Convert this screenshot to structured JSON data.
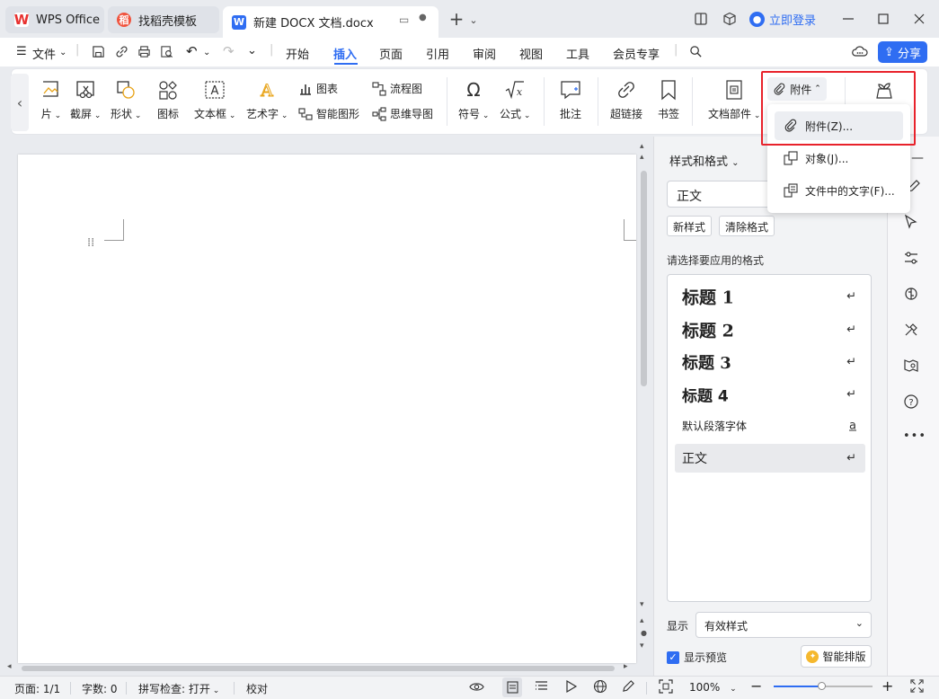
{
  "tabs": [
    {
      "label": "WPS Office",
      "icon": "wps-logo-icon"
    },
    {
      "label": "找稻壳模板",
      "icon": "daoke-icon"
    },
    {
      "label": "新建 DOCX 文档.docx",
      "icon": "word-doc-icon"
    }
  ],
  "titlebar": {
    "login": "立即登录"
  },
  "menu": {
    "file": "文件",
    "tabs": [
      "开始",
      "插入",
      "页面",
      "引用",
      "审阅",
      "视图",
      "工具",
      "会员专享"
    ],
    "active_tab": "插入",
    "share": "分享"
  },
  "ribbon": {
    "picture_partial": "片",
    "screenshot": "截屏",
    "shape": "形状",
    "icon": "图标",
    "textbox": "文本框",
    "wordart": "艺术字",
    "chart": "图表",
    "smartart": "智能图形",
    "flowchart": "流程图",
    "mindmap": "思维导图",
    "symbol": "符号",
    "formula": "公式",
    "comment": "批注",
    "hyperlink": "超链接",
    "bookmark": "书签",
    "docparts": "文档部件",
    "attachment": "附件"
  },
  "dropdown": {
    "items": [
      "附件(Z)...",
      "对象(J)...",
      "文件中的文字(F)..."
    ]
  },
  "styles_pane": {
    "title": "样式和格式",
    "current_style": "正文",
    "new_style": "新样式",
    "clear_format": "清除格式",
    "hint": "请选择要应用的格式",
    "styles": [
      {
        "name": "标题  1",
        "mark": "↵"
      },
      {
        "name": "标题  2",
        "mark": "↵"
      },
      {
        "name": "标题  3",
        "mark": "↵"
      },
      {
        "name": "标题  4",
        "mark": "↵"
      },
      {
        "name": "默认段落字体",
        "mark": "a"
      },
      {
        "name": "正文",
        "mark": "↵"
      }
    ],
    "show_label": "显示",
    "show_value": "有效样式",
    "preview_label": "显示预览",
    "smart_layout": "智能排版"
  },
  "statusbar": {
    "page": "页面: 1/1",
    "words": "字数: 0",
    "spellcheck": "拼写检查: 打开",
    "proofread": "校对",
    "zoom": "100%"
  },
  "colors": {
    "accent": "#2f6df2",
    "highlight_box": "#e8222b"
  }
}
